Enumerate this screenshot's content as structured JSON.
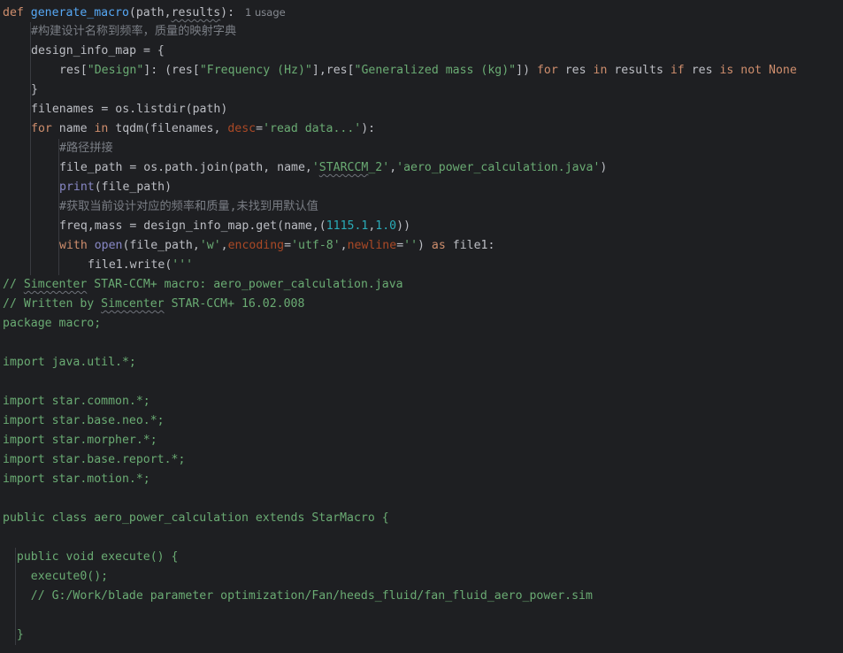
{
  "editor": {
    "usage_hint": "1 usage",
    "lines": [
      [
        [
          "kw",
          "def "
        ],
        [
          "fn",
          "generate_macro"
        ],
        [
          "plain",
          "(path,"
        ],
        [
          "plain_sq",
          "results"
        ],
        [
          "plain",
          "):"
        ]
      ],
      [
        [
          "cmt",
          "#构建设计名称到频率，质量的映射字典"
        ]
      ],
      [
        [
          "plain",
          "design_info_map = {"
        ]
      ],
      [
        [
          "plain",
          "res["
        ],
        [
          "str",
          "\"Design\""
        ],
        [
          "plain",
          "]: (res["
        ],
        [
          "str",
          "\"Frequency (Hz)\""
        ],
        [
          "plain",
          "],res["
        ],
        [
          "str",
          "\"Generalized mass (kg)\""
        ],
        [
          "plain",
          "]) "
        ],
        [
          "kw",
          "for"
        ],
        [
          "plain",
          " res "
        ],
        [
          "kw",
          "in"
        ],
        [
          "plain",
          " results "
        ],
        [
          "kw",
          "if"
        ],
        [
          "plain",
          " res "
        ],
        [
          "kw",
          "is not"
        ],
        [
          "plain",
          " "
        ],
        [
          "kw",
          "None"
        ]
      ],
      [
        [
          "plain",
          "}"
        ]
      ],
      [
        [
          "plain",
          "filenames = os.listdir(path)"
        ]
      ],
      [
        [
          "kw",
          "for"
        ],
        [
          "plain",
          " name "
        ],
        [
          "kw",
          "in"
        ],
        [
          "plain",
          " tqdm(filenames, "
        ],
        [
          "prm",
          "desc"
        ],
        [
          "plain",
          "="
        ],
        [
          "str",
          "'read data...'"
        ],
        [
          "plain",
          "):"
        ]
      ],
      [
        [
          "cmt",
          "#路径拼接"
        ]
      ],
      [
        [
          "plain",
          "file_path = os.path.join(path, name,"
        ],
        [
          "str",
          "'"
        ],
        [
          "str_sq",
          "STARCCM"
        ],
        [
          "str",
          "_2'"
        ],
        [
          "plain",
          ","
        ],
        [
          "str",
          "'aero_power_calculation.java'"
        ],
        [
          "plain",
          ")"
        ]
      ],
      [
        [
          "bi",
          "print"
        ],
        [
          "plain",
          "(file_path)"
        ]
      ],
      [
        [
          "cmt",
          "#获取当前设计对应的频率和质量,未找到用默认值"
        ]
      ],
      [
        [
          "plain",
          "freq,mass = design_info_map.get(name,("
        ],
        [
          "num",
          "1115.1"
        ],
        [
          "plain",
          ","
        ],
        [
          "num",
          "1.0"
        ],
        [
          "plain",
          "))"
        ]
      ],
      [
        [
          "kw",
          "with "
        ],
        [
          "bi",
          "open"
        ],
        [
          "plain",
          "(file_path,"
        ],
        [
          "str",
          "'w'"
        ],
        [
          "plain",
          ","
        ],
        [
          "prm",
          "encoding"
        ],
        [
          "plain",
          "="
        ],
        [
          "str",
          "'utf-8'"
        ],
        [
          "plain",
          ","
        ],
        [
          "prm",
          "newline"
        ],
        [
          "plain",
          "="
        ],
        [
          "str",
          "''"
        ],
        [
          "plain",
          ") "
        ],
        [
          "kw",
          "as"
        ],
        [
          "plain",
          " file1:"
        ]
      ],
      [
        [
          "plain",
          "file1.write("
        ],
        [
          "str",
          "'''"
        ]
      ],
      [
        [
          "str",
          "// "
        ],
        [
          "str_sq",
          "Simcenter"
        ],
        [
          "str",
          " STAR-CCM+ macro: aero_power_calculation.java"
        ]
      ],
      [
        [
          "str",
          "// Written by "
        ],
        [
          "str_sq",
          "Simcenter"
        ],
        [
          "str",
          " STAR-CCM+ 16.02.008"
        ]
      ],
      [
        [
          "str",
          "package macro;"
        ]
      ],
      [],
      [
        [
          "str",
          "import java.util.*;"
        ]
      ],
      [],
      [
        [
          "str",
          "import star.common.*;"
        ]
      ],
      [
        [
          "str",
          "import star.base.neo.*;"
        ]
      ],
      [
        [
          "str",
          "import star.morpher.*;"
        ]
      ],
      [
        [
          "str",
          "import star.base.report.*;"
        ]
      ],
      [
        [
          "str",
          "import star.motion.*;"
        ]
      ],
      [],
      [
        [
          "str",
          "public class aero_power_calculation extends StarMacro {"
        ]
      ],
      [],
      [
        [
          "str",
          "  public void execute() {"
        ]
      ],
      [
        [
          "str",
          "    execute0();"
        ]
      ],
      [
        [
          "str",
          "    // G:/Work/blade parameter optimization/Fan/heeds_fluid/fan_fluid_aero_power.sim"
        ]
      ],
      [],
      [
        [
          "str",
          "  }"
        ]
      ]
    ]
  }
}
